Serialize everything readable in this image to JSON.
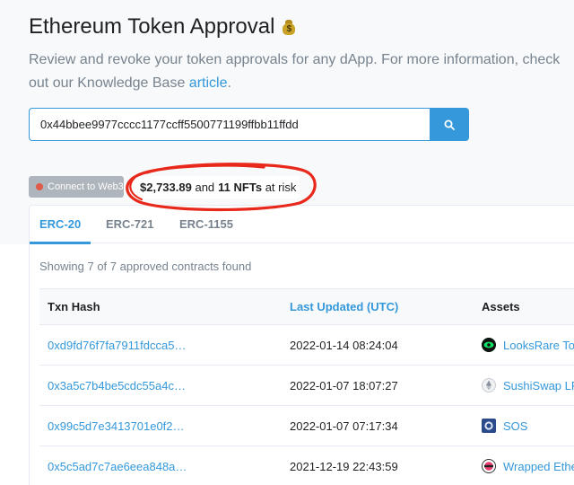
{
  "header": {
    "title": "Ethereum Token Approval",
    "title_icon": "money-bag-icon",
    "subtitle_text": "Review and revoke your token approvals for any dApp. For more information, check out our Knowledge Base ",
    "subtitle_link": "article",
    "subtitle_end": "."
  },
  "search": {
    "value": "0x44bbee9977cccc1177ccff5500771199ffbb11ffdd",
    "button_icon": "search-icon"
  },
  "wallet": {
    "connect_label": "Connect to Web3",
    "risk_amount": "$2,733.89",
    "risk_and": "and",
    "risk_nft_count": "11 NFTs",
    "risk_suffix": "at risk"
  },
  "tabs": [
    {
      "label": "ERC-20",
      "active": true
    },
    {
      "label": "ERC-721",
      "active": false
    },
    {
      "label": "ERC-1155",
      "active": false
    }
  ],
  "summary": "Showing 7 of 7 approved contracts found",
  "table": {
    "columns": [
      "Txn Hash",
      "Last Updated (UTC)",
      "Assets"
    ],
    "rows": [
      {
        "hash": "0xd9fd76f7fa7911fdcca5…",
        "updated": "2022-01-14 08:24:04",
        "asset": "LooksRare To",
        "asset_icon": "looksrare-icon"
      },
      {
        "hash": "0x3a5c7b4be5cdc55a4c…",
        "updated": "2022-01-07 18:07:27",
        "asset": "SushiSwap LP",
        "asset_icon": "ethereum-icon"
      },
      {
        "hash": "0x99c5d7e3413701e0f2…",
        "updated": "2022-01-07 07:17:34",
        "asset": "SOS",
        "asset_icon": "sos-icon"
      },
      {
        "hash": "0x5c5ad7c7ae6eea848a…",
        "updated": "2021-12-19 22:43:59",
        "asset": "Wrapped Ethe",
        "asset_icon": "weth-icon"
      }
    ]
  },
  "colors": {
    "accent": "#3498db",
    "annotation": "#e8281b"
  }
}
